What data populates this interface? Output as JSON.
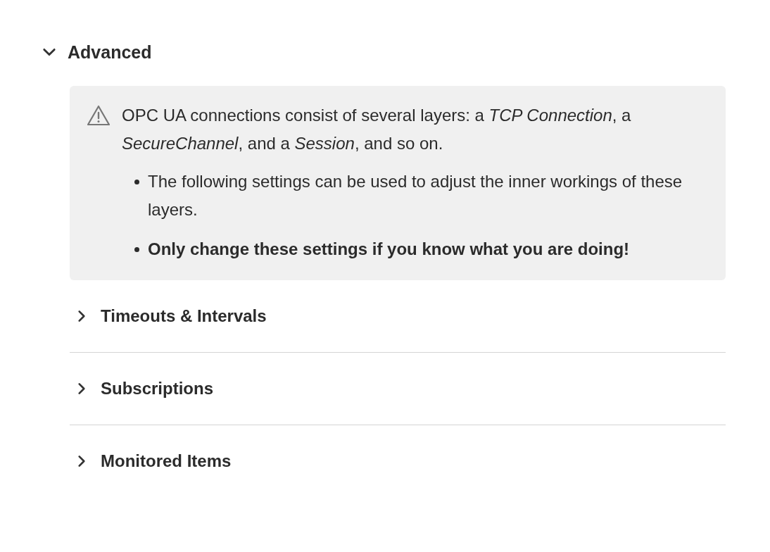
{
  "section": {
    "title": "Advanced",
    "expanded": true
  },
  "notice": {
    "text": "OPC UA connections consist of several layers: a *TCP Connection*, a *SecureChannel*, and a *Session*, and so on.",
    "bullets": [
      {
        "text": "The following settings can be used to adjust the inner workings of these layers.",
        "bold": false
      },
      {
        "text": "Only change these settings if you know what you are doing!",
        "bold": true
      }
    ]
  },
  "subsections": [
    {
      "title": "Timeouts & Intervals",
      "expanded": false
    },
    {
      "title": "Subscriptions",
      "expanded": false
    },
    {
      "title": "Monitored Items",
      "expanded": false
    }
  ]
}
